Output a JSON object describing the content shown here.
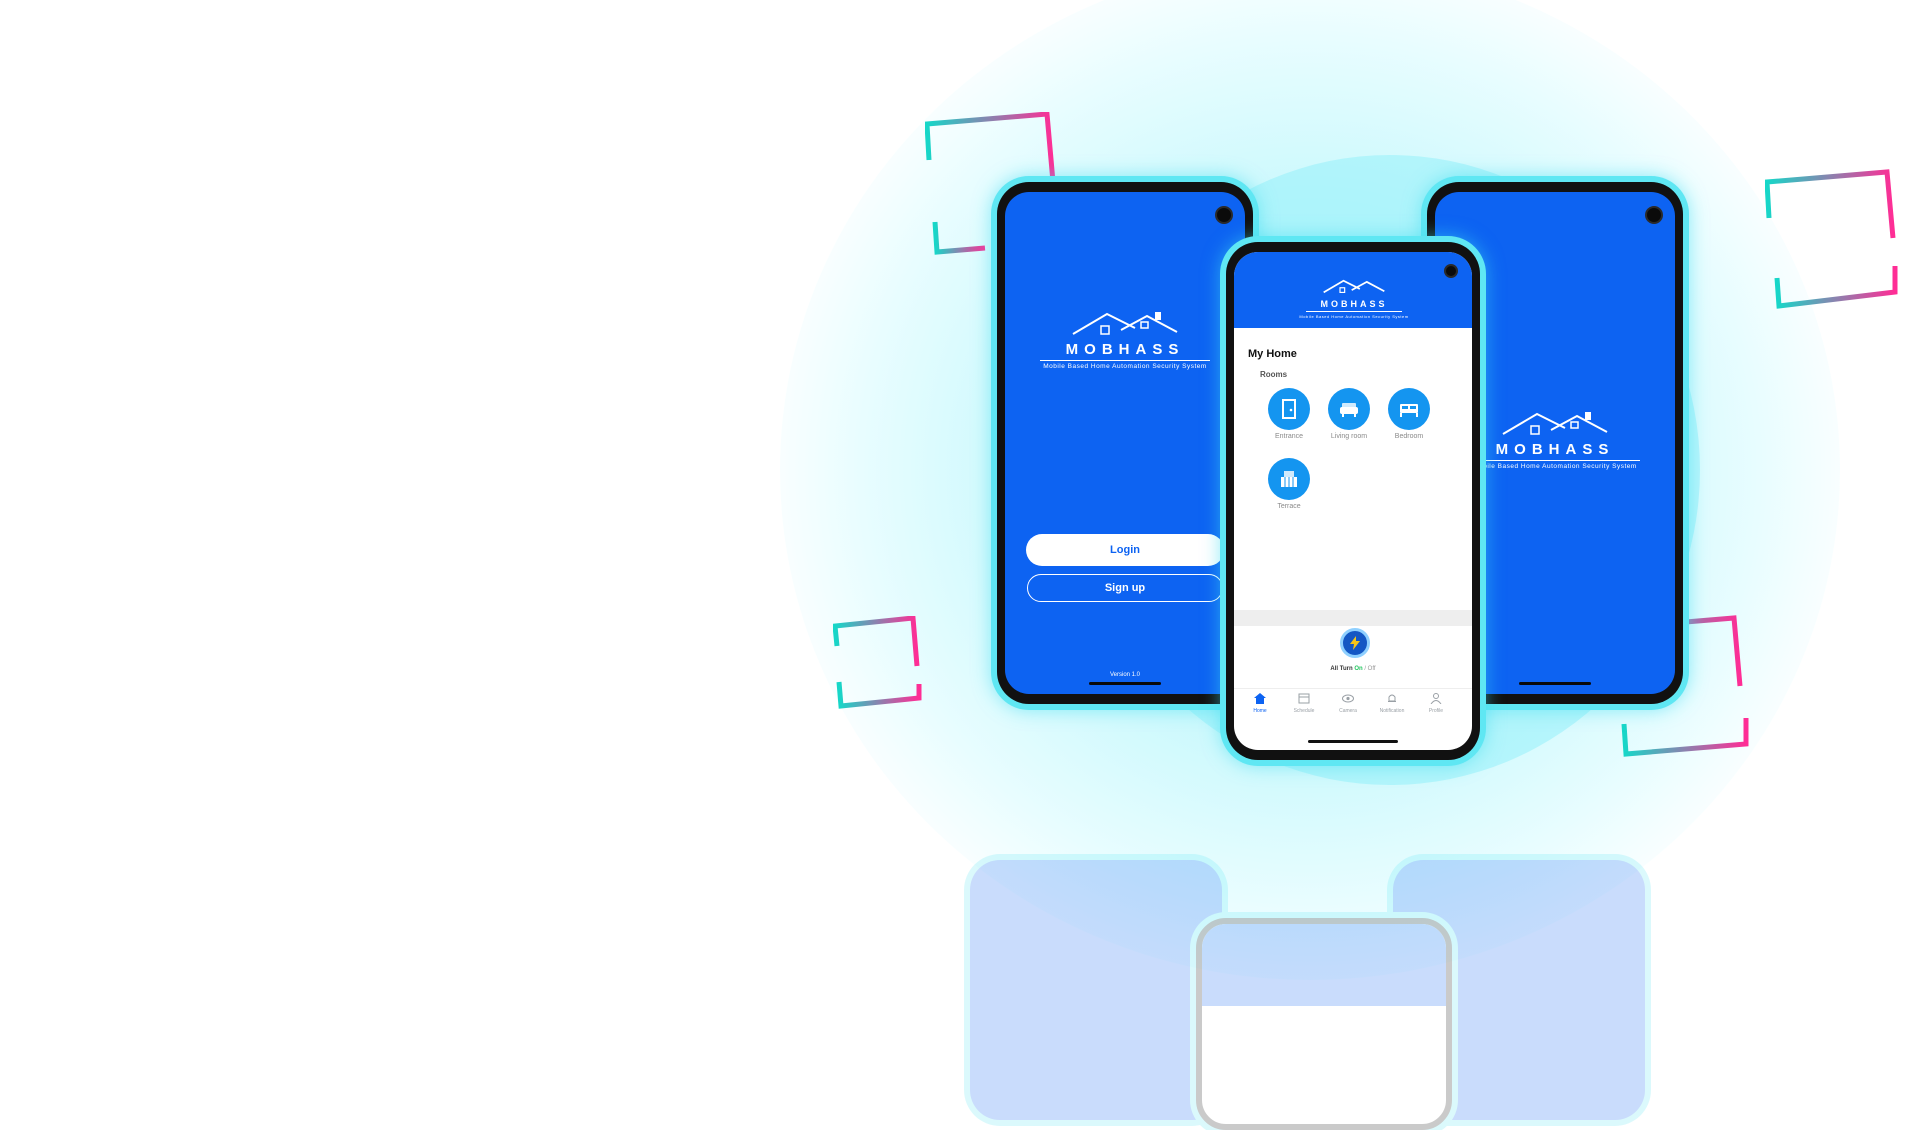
{
  "brand": {
    "name": "MOBHASS",
    "tagline": "Mobile Based Home Automation Security System"
  },
  "login_screen": {
    "login_label": "Login",
    "signup_label": "Sign up",
    "version": "Version 1.0"
  },
  "home_screen": {
    "title": "My Home",
    "rooms_label": "Rooms",
    "rooms": [
      {
        "label": "Entrance",
        "icon": "door-icon"
      },
      {
        "label": "Living room",
        "icon": "sofa-icon"
      },
      {
        "label": "Bedroom",
        "icon": "bed-icon"
      },
      {
        "label": "Terrace",
        "icon": "terrace-icon"
      }
    ],
    "power": {
      "prefix": "All Turn",
      "on": "On",
      "sep": " / ",
      "off": "Off"
    },
    "nav": [
      {
        "label": "Home",
        "icon": "home-icon",
        "active": true
      },
      {
        "label": "Schedule",
        "icon": "calendar-icon",
        "active": false
      },
      {
        "label": "Camera",
        "icon": "eye-icon",
        "active": false
      },
      {
        "label": "Notification",
        "icon": "bell-icon",
        "active": false
      },
      {
        "label": "Profile",
        "icon": "user-icon",
        "active": false
      }
    ]
  },
  "colors": {
    "app_blue": "#0d63f2",
    "room_blue": "#1495f0",
    "glow_cyan": "#5fe7f3",
    "frame_pink": "#ff2d95",
    "frame_teal": "#16d7c8",
    "on_green": "#22c55e"
  }
}
